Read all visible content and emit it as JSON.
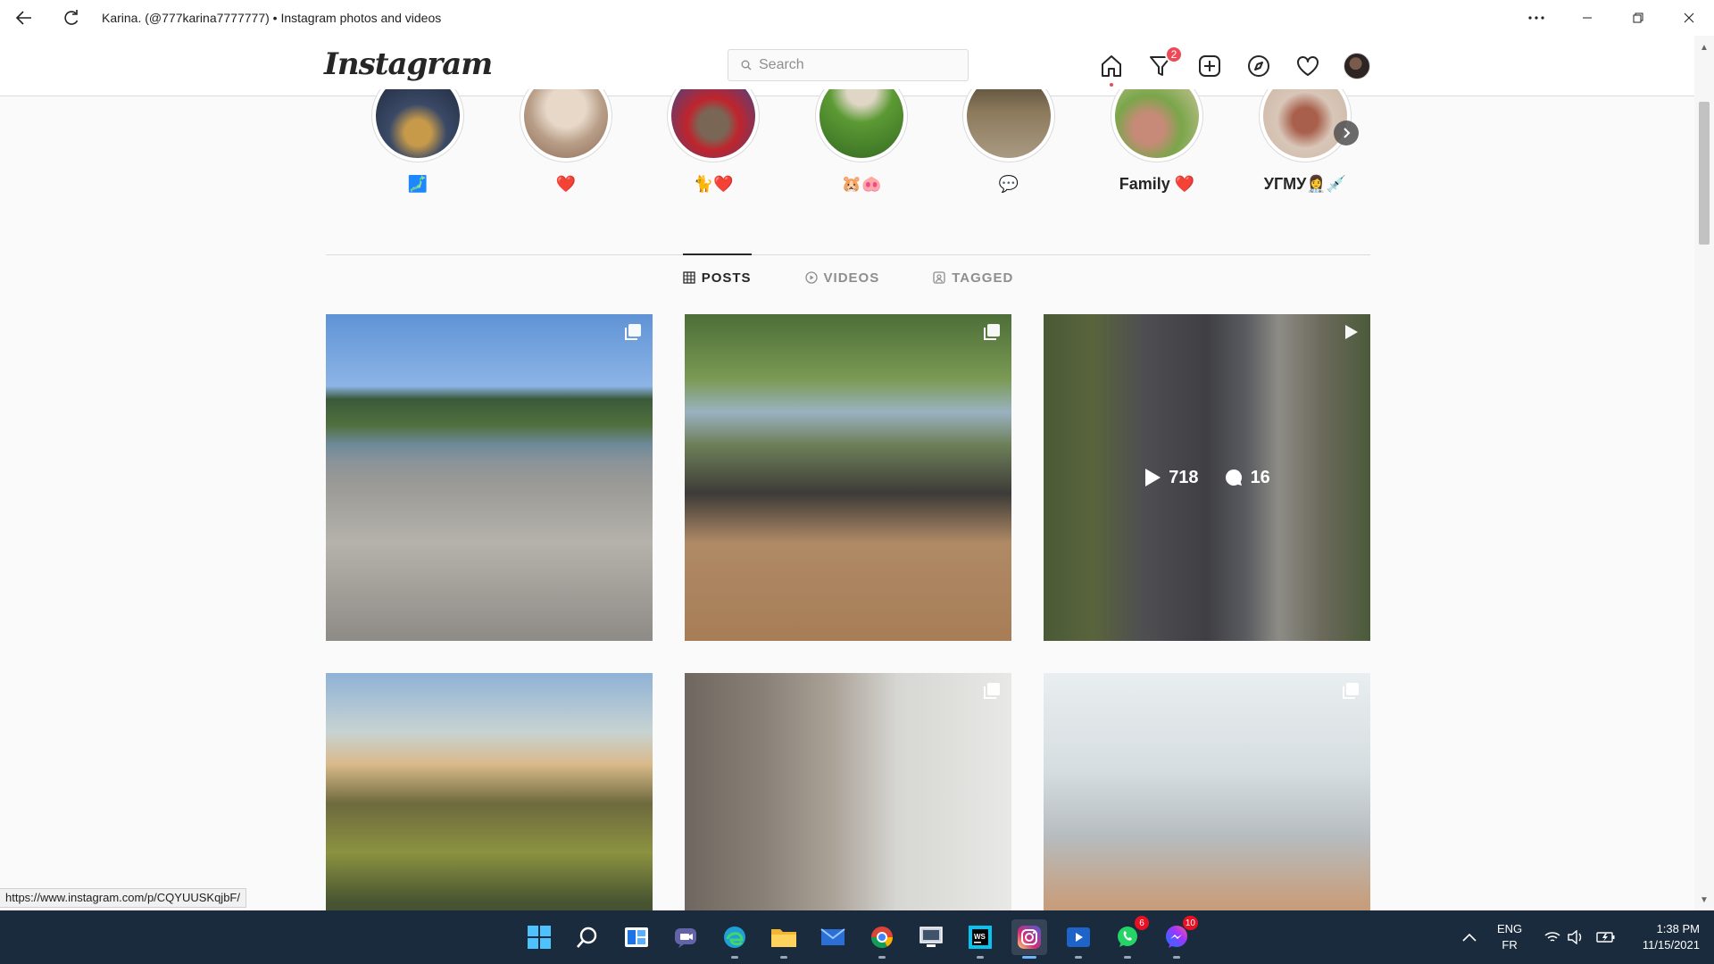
{
  "window": {
    "title": "Karina. (@777karina7777777) • Instagram photos and videos"
  },
  "header": {
    "logo": "Instagram",
    "search_placeholder": "Search",
    "direct_badge": "2"
  },
  "highlights": [
    {
      "label": "🗾",
      "colors": [
        "#2c3a55",
        "#c79a4a"
      ]
    },
    {
      "label": "❤️",
      "colors": [
        "#cbb8a8",
        "#8e6a55"
      ]
    },
    {
      "label": "🐈❤️",
      "colors": [
        "#c0242c",
        "#2a4d9a"
      ]
    },
    {
      "label": "🐹🐽",
      "colors": [
        "#4e8a2e",
        "#d8d0c0"
      ]
    },
    {
      "label": "💬",
      "colors": [
        "#6b5a40",
        "#9a8d78"
      ]
    },
    {
      "label": "Family ❤️",
      "colors": [
        "#7aa64a",
        "#c88a78"
      ]
    },
    {
      "label": "УГМУ👩‍⚕️💉",
      "colors": [
        "#d8c6b8",
        "#8c5a48"
      ]
    }
  ],
  "tabs": [
    {
      "label": "POSTS",
      "active": true
    },
    {
      "label": "VIDEOS",
      "active": false
    },
    {
      "label": "TAGGED",
      "active": false
    }
  ],
  "posts": [
    {
      "type": "carousel",
      "hover": false
    },
    {
      "type": "carousel",
      "hover": false
    },
    {
      "type": "video",
      "hover": true,
      "views": "718",
      "comments": "16"
    },
    {
      "type": "photo",
      "hover": false
    },
    {
      "type": "carousel",
      "hover": false
    },
    {
      "type": "carousel",
      "hover": false
    }
  ],
  "status_url": "https://www.instagram.com/p/CQYUUSKqjbF/",
  "taskbar": {
    "apps": [
      {
        "name": "start-icon"
      },
      {
        "name": "search-icon"
      },
      {
        "name": "widgets-icon"
      },
      {
        "name": "teams-chat-icon"
      },
      {
        "name": "edge-icon"
      },
      {
        "name": "file-explorer-icon"
      },
      {
        "name": "mail-icon"
      },
      {
        "name": "chrome-icon"
      },
      {
        "name": "remote-desktop-icon"
      },
      {
        "name": "webstorm-icon"
      },
      {
        "name": "instagram-icon"
      },
      {
        "name": "media-player-icon"
      },
      {
        "name": "whatsapp-icon"
      },
      {
        "name": "messenger-icon"
      }
    ],
    "whatsapp_badge": "6",
    "messenger_badge": "10",
    "lang_top": "ENG",
    "lang_bottom": "FR",
    "time": "1:38 PM",
    "date": "11/15/2021"
  }
}
